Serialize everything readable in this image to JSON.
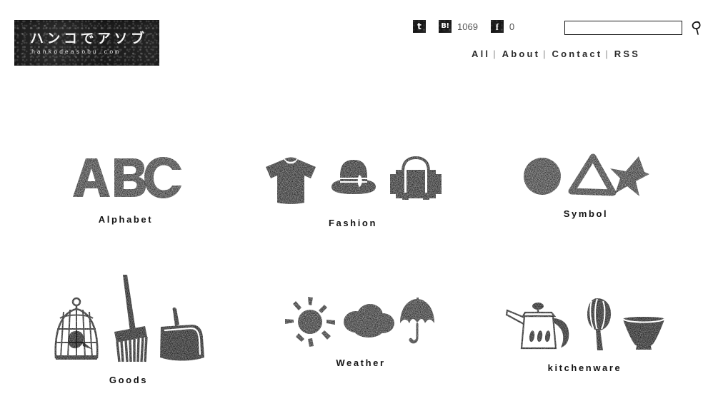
{
  "site": {
    "logo_jp": "ハンコでアソブ",
    "logo_url": "hankodeasobu.com"
  },
  "header": {
    "social": [
      {
        "name": "twitter",
        "icon": "twitter-icon",
        "glyph": "t",
        "count": ""
      },
      {
        "name": "hatena",
        "icon": "hatena-bookmark-icon",
        "glyph": "B!",
        "count": "1069"
      },
      {
        "name": "facebook",
        "icon": "facebook-icon",
        "glyph": "f",
        "count": "0"
      }
    ],
    "search": {
      "value": "",
      "placeholder": "",
      "icon": "search-icon"
    },
    "nav": {
      "separator": "|",
      "items": [
        {
          "label": "All"
        },
        {
          "label": "About"
        },
        {
          "label": "Contact"
        },
        {
          "label": "RSS"
        }
      ]
    }
  },
  "main": {
    "categories": [
      {
        "label": "Alphabet",
        "icons": [
          "letter-a-stamp",
          "letter-b-stamp",
          "letter-c-stamp"
        ]
      },
      {
        "label": "Fashion",
        "icons": [
          "tshirt-stamp",
          "hat-stamp",
          "suitcase-stamp"
        ]
      },
      {
        "label": "Symbol",
        "icons": [
          "circle-stamp",
          "triangle-stamp",
          "star-stamp"
        ]
      },
      {
        "label": "Goods",
        "icons": [
          "birdcage-stamp",
          "broom-stamp",
          "dustpan-stamp"
        ]
      },
      {
        "label": "Weather",
        "icons": [
          "sun-stamp",
          "cloud-stamp",
          "umbrella-stamp"
        ]
      },
      {
        "label": "kitchenware",
        "icons": [
          "kettle-stamp",
          "whisk-stamp",
          "bowl-stamp"
        ]
      }
    ]
  },
  "colors": {
    "ink": "#141414",
    "page_background": "#ffffff",
    "count_text": "#555555",
    "nav_text": "#2a2a2a"
  }
}
